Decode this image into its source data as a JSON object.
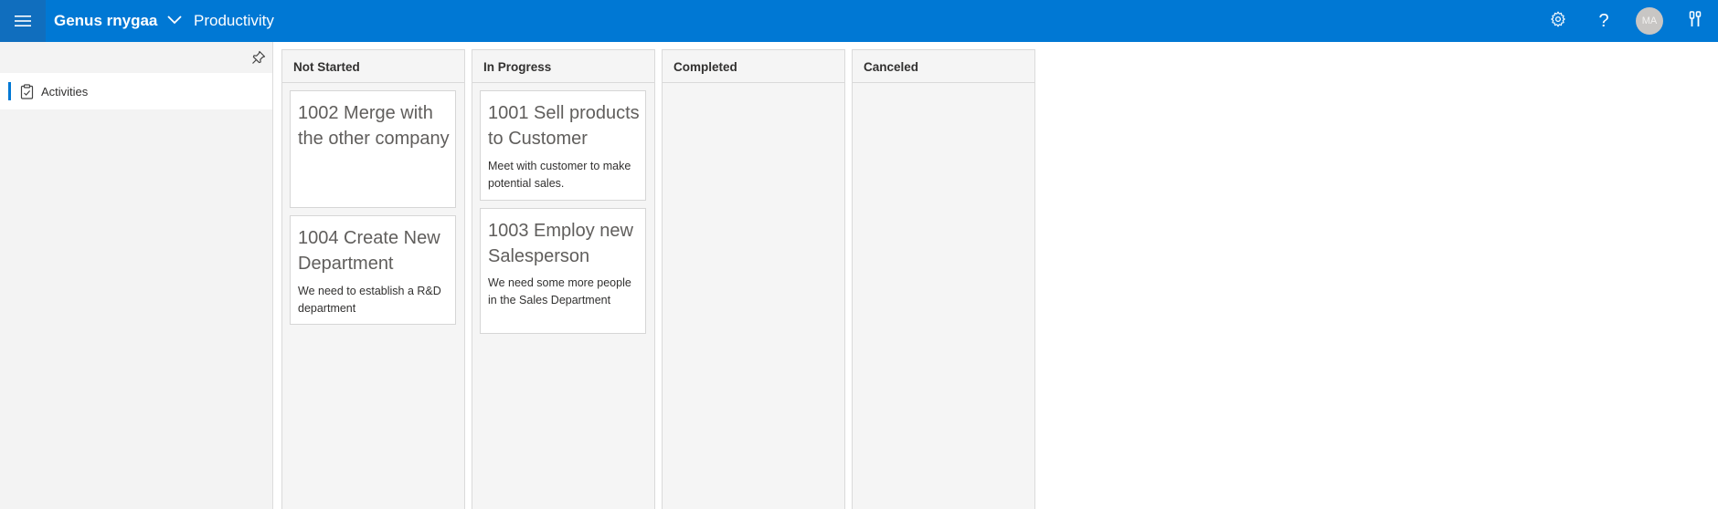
{
  "header": {
    "app_name": "Genus rnygaa",
    "module_name": "Productivity",
    "avatar_initials": "MA",
    "bar_color": "#0078d4",
    "icons": [
      "menu-icon",
      "chevron-down-icon",
      "gear-icon",
      "help-icon",
      "tools-icon"
    ]
  },
  "sidebar": {
    "pin_icon": "pin-icon",
    "items": [
      {
        "label": "Activities",
        "icon": "clipboard-check-icon",
        "selected": true
      }
    ]
  },
  "board": {
    "columns": [
      {
        "title": "Not Started",
        "cards": [
          {
            "title": "1002 Merge with the other company",
            "description": ""
          },
          {
            "title": "1004 Create New Department",
            "description": "We need to establish a R&D department"
          }
        ]
      },
      {
        "title": "In Progress",
        "cards": [
          {
            "title": "1001 Sell products to Customer",
            "description": "Meet with customer to make potential sales."
          },
          {
            "title": "1003 Employ new Salesperson",
            "description": "We need some more people in the Sales Department"
          }
        ]
      },
      {
        "title": "Completed",
        "cards": []
      },
      {
        "title": "Canceled",
        "cards": []
      }
    ]
  }
}
